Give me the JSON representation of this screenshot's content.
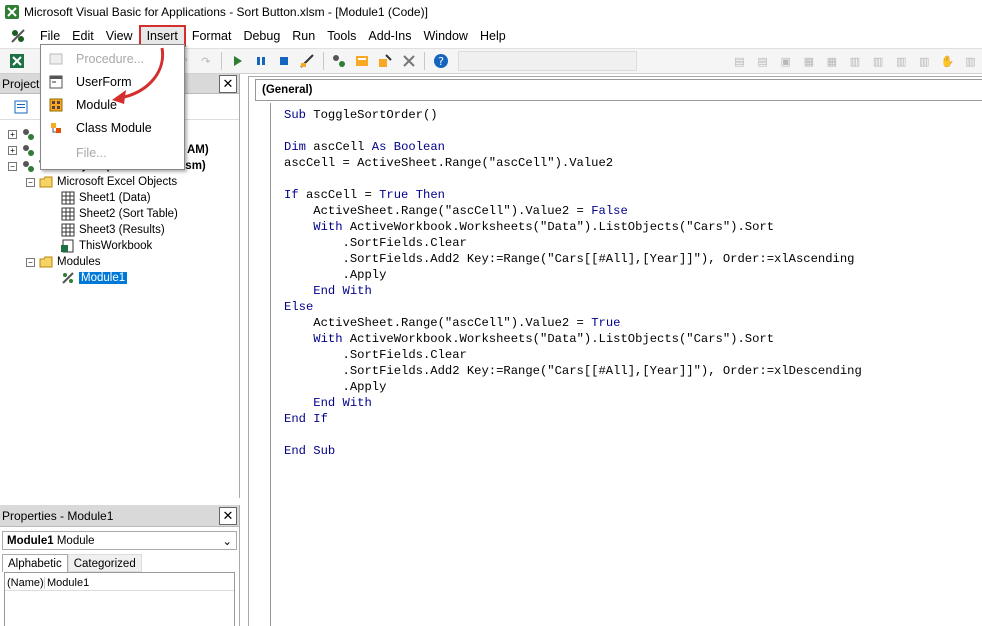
{
  "titlebar": {
    "title": "Microsoft Visual Basic for Applications - Sort Button.xlsm - [Module1 (Code)]"
  },
  "menubar": {
    "items": [
      {
        "label": "File"
      },
      {
        "label": "Edit"
      },
      {
        "label": "View"
      },
      {
        "label": "Insert"
      },
      {
        "label": "Format"
      },
      {
        "label": "Debug"
      },
      {
        "label": "Run"
      },
      {
        "label": "Tools"
      },
      {
        "label": "Add-Ins"
      },
      {
        "label": "Window"
      },
      {
        "label": "Help"
      }
    ],
    "active": "Insert"
  },
  "insert_menu": {
    "items": [
      {
        "label": "Procedure...",
        "enabled": false,
        "icon": "procedure-icon"
      },
      {
        "label": "UserForm",
        "enabled": true,
        "icon": "userform-icon"
      },
      {
        "label": "Module",
        "enabled": true,
        "icon": "module-icon"
      },
      {
        "label": "Class Module",
        "enabled": true,
        "icon": "class-module-icon"
      },
      {
        "label": "File...",
        "enabled": false,
        "icon": ""
      }
    ],
    "highlight_color": "#d32f2f"
  },
  "project": {
    "title": "Project",
    "tree": {
      "partial_label": "AM)",
      "vbaproject": "VBAProject (Sort Button.xlsm)",
      "excel_objects": "Microsoft Excel Objects",
      "sheets": [
        "Sheet1 (Data)",
        "Sheet2 (Sort Table)",
        "Sheet3 (Results)",
        "ThisWorkbook"
      ],
      "modules": "Modules",
      "module1": "Module1"
    }
  },
  "properties": {
    "title": "Properties - Module1",
    "object_name": "Module1",
    "object_type": "Module",
    "tabs": [
      "Alphabetic",
      "Categorized"
    ],
    "rows": [
      {
        "name": "(Name)",
        "value": "Module1"
      }
    ]
  },
  "code": {
    "object_combo": "(General)",
    "lines": [
      "Sub ToggleSortOrder()",
      "",
      "Dim ascCell As Boolean",
      "ascCell = ActiveSheet.Range(\"ascCell\").Value2",
      "",
      "If ascCell = True Then",
      "    ActiveSheet.Range(\"ascCell\").Value2 = False",
      "    With ActiveWorkbook.Worksheets(\"Data\").ListObjects(\"Cars\").Sort",
      "        .SortFields.Clear",
      "        .SortFields.Add2 Key:=Range(\"Cars[[#All],[Year]]\"), Order:=xlAscending",
      "        .Apply",
      "    End With",
      "Else",
      "    ActiveSheet.Range(\"ascCell\").Value2 = True",
      "    With ActiveWorkbook.Worksheets(\"Data\").ListObjects(\"Cars\").Sort",
      "        .SortFields.Clear",
      "        .SortFields.Add2 Key:=Range(\"Cars[[#All],[Year]]\"), Order:=xlDescending",
      "        .Apply",
      "    End With",
      "End If",
      "",
      "End Sub"
    ],
    "keyword_color": "#00008b"
  }
}
